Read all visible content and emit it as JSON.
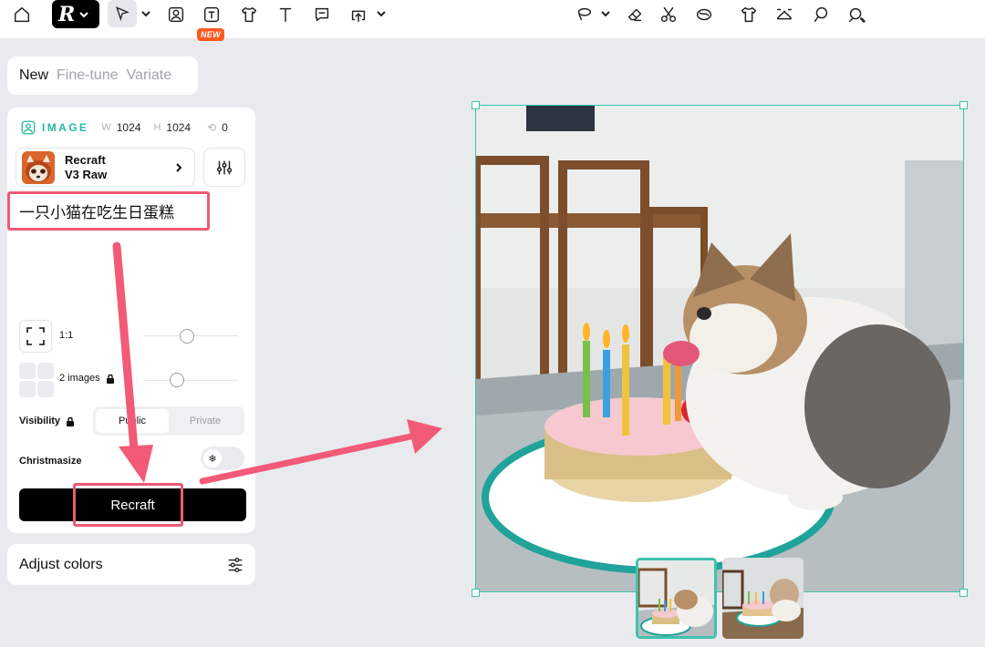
{
  "toolbar": {
    "new_badge": "NEW"
  },
  "tabs": [
    {
      "label": "New",
      "active": true
    },
    {
      "label": "Fine-tune",
      "active": false
    },
    {
      "label": "Variate",
      "active": false
    }
  ],
  "image_settings": {
    "label": "IMAGE",
    "width_label": "W",
    "width": "1024",
    "height_label": "H",
    "height": "1024",
    "rotation": "0"
  },
  "model": {
    "line1": "Recraft",
    "line2": "V3 Raw"
  },
  "prompt": {
    "text": "一只小猫在吃生日蛋糕"
  },
  "ratio": {
    "label": "1:1"
  },
  "images_count": {
    "label": "2 images"
  },
  "visibility": {
    "label": "Visibility",
    "options": [
      "Public",
      "Private"
    ],
    "selected": "Public"
  },
  "christmasize": {
    "label": "Christmasize"
  },
  "generate": {
    "label": "Recraft"
  },
  "adjust_colors": {
    "label": "Adjust colors"
  },
  "colors": {
    "accent": "#3fc2ad",
    "highlight": "#ee5a76",
    "badge": "#ff5a1f"
  }
}
